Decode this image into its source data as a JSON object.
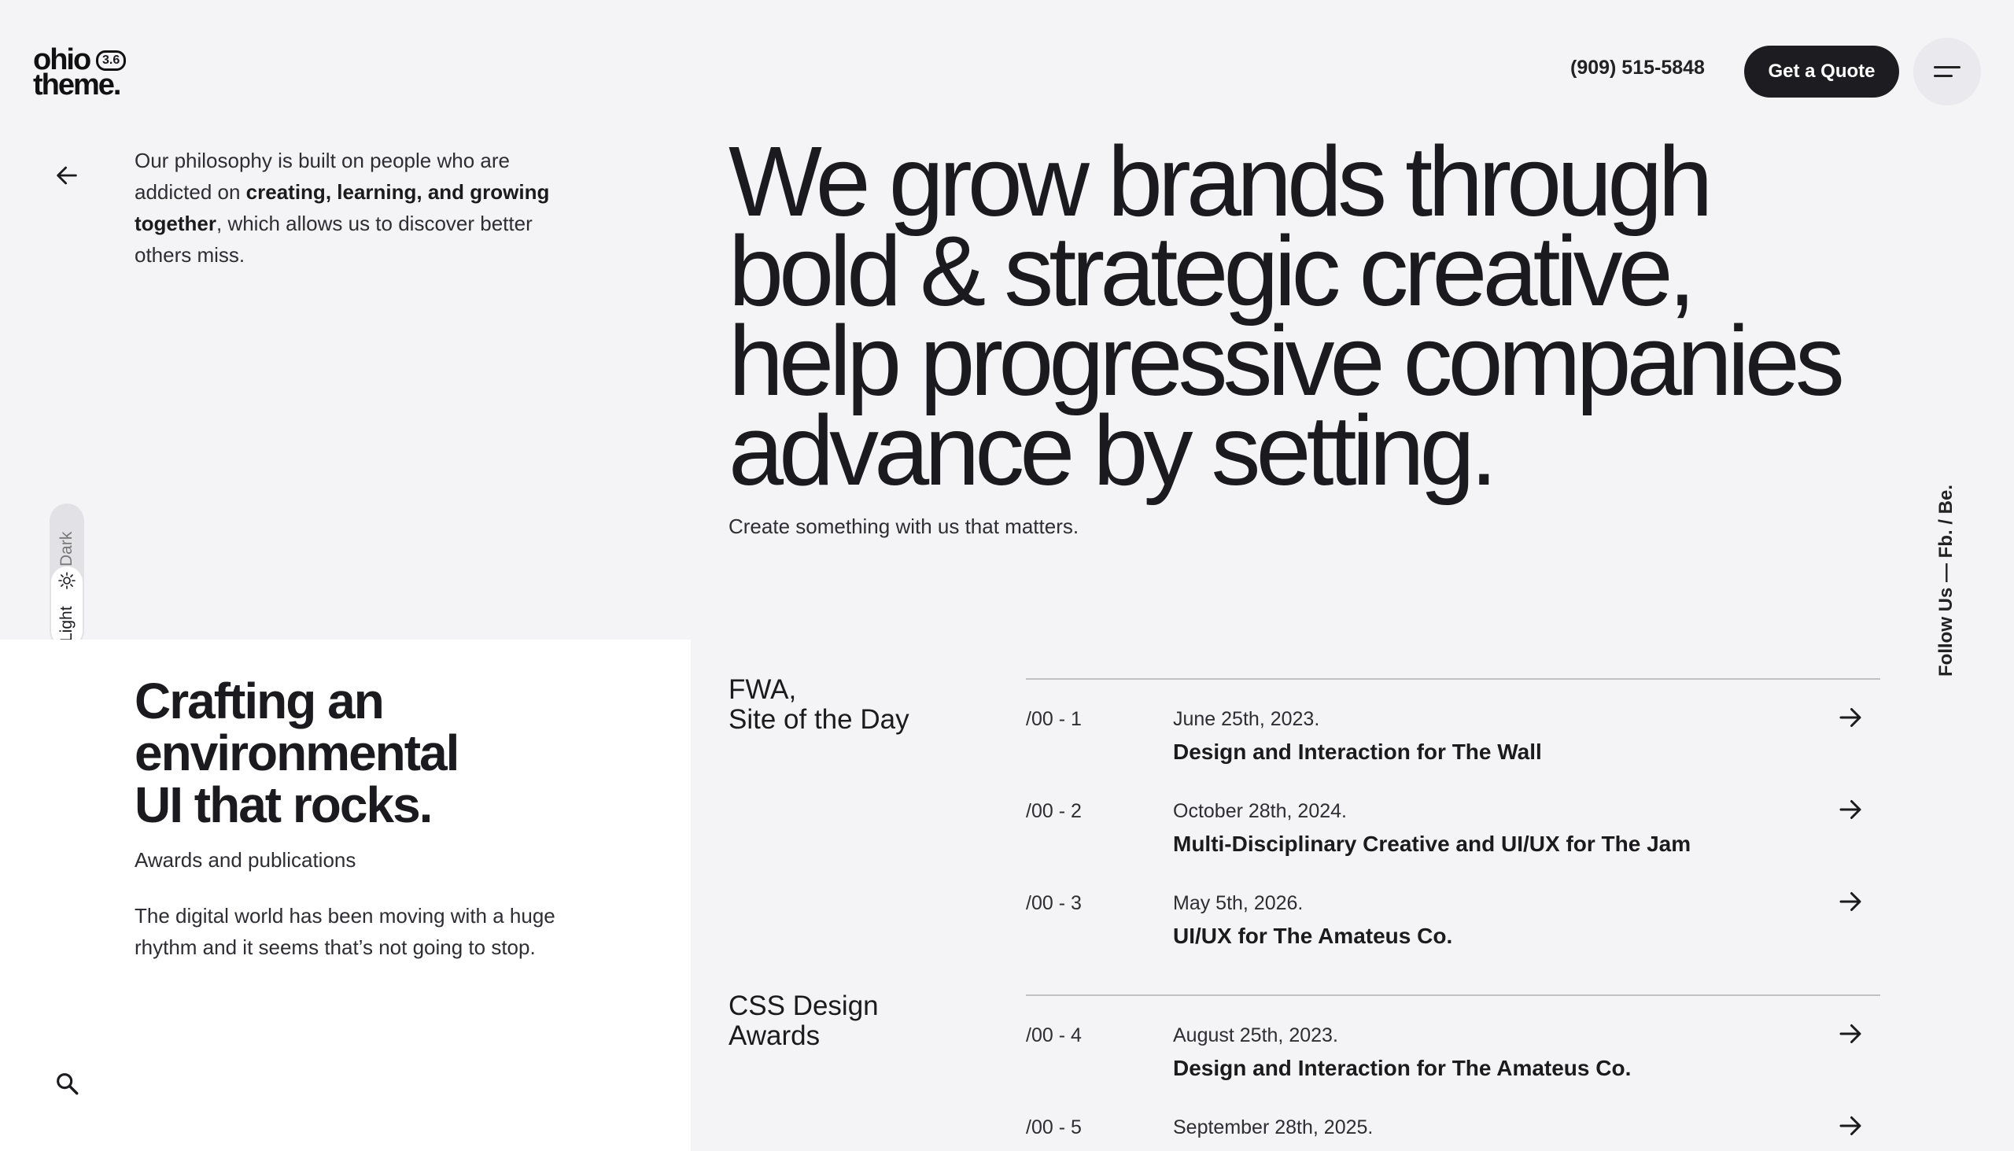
{
  "header": {
    "logo_line1": "ohio",
    "logo_line2": "theme.",
    "logo_version": "3.6",
    "phone": "(909) 515-5848",
    "quote_label": "Get a Quote"
  },
  "philosophy": {
    "part1": "Our philosophy is built on people who are addicted on ",
    "bold": "creating, learning, and growing together",
    "part2": ", which allows us to discover better others miss."
  },
  "hero": {
    "line1": "We grow brands through",
    "line2": "bold & strategic creative,",
    "line3": "help progressive companies",
    "line4": "advance by setting.",
    "subtitle": "Create something with us that matters."
  },
  "theme_toggle": {
    "dark_label": "Dark",
    "light_label": "Light",
    "selected": "Light"
  },
  "follow": {
    "label": "Follow Us — Fb. / Be."
  },
  "panel": {
    "title_line1": "Crafting an",
    "title_line2": "environmental",
    "title_line3": "UI that rocks.",
    "subtitle": "Awards and publications",
    "description": "The digital world has been moving with a huge rhythm and it seems that’s not going to stop."
  },
  "awards": {
    "groups": [
      {
        "name_line1": "FWA,",
        "name_line2": "Site of the Day",
        "items": [
          {
            "index": "/00 - 1",
            "date": "June 25th, 2023.",
            "title": "Design and Interaction for The Wall"
          },
          {
            "index": "/00 - 2",
            "date": "October 28th, 2024.",
            "title": "Multi-Disciplinary Creative and UI/UX for The Jam"
          },
          {
            "index": "/00 - 3",
            "date": "May 5th, 2026.",
            "title": "UI/UX for The Amateus Co."
          }
        ]
      },
      {
        "name_line1": "CSS Design",
        "name_line2": "Awards",
        "items": [
          {
            "index": "/00 - 4",
            "date": "August 25th, 2023.",
            "title": "Design and Interaction for The Amateus Co."
          },
          {
            "index": "/00 - 5",
            "date": "September 28th, 2025.",
            "title": ""
          }
        ]
      }
    ]
  },
  "icons": {
    "back": "arrow-left-icon",
    "menu": "hamburger-menu-icon",
    "theme": "sun-icon",
    "search": "search-icon",
    "row_arrow": "arrow-right-icon"
  }
}
